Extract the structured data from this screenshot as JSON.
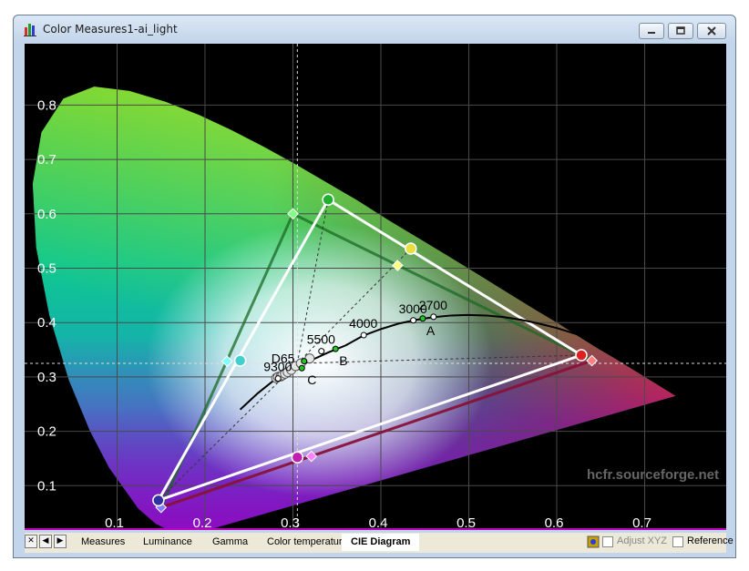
{
  "window": {
    "title": "Color Measures1-ai_light",
    "controls": [
      "minimize",
      "maximize",
      "close"
    ]
  },
  "chart_data": {
    "type": "scatter",
    "title": "",
    "xlabel": "",
    "ylabel": "",
    "xlim": [
      0,
      0.8
    ],
    "ylim": [
      0,
      0.9
    ],
    "x_ticks": [
      "0.1",
      "0.2",
      "0.3",
      "0.4",
      "0.5",
      "0.6",
      "0.7"
    ],
    "y_ticks": [
      "0.1",
      "0.2",
      "0.3",
      "0.4",
      "0.5",
      "0.6",
      "0.7",
      "0.8"
    ],
    "grid": true,
    "watermark": "hcfr.sourceforge.net",
    "reference_gamut": {
      "red": [
        0.64,
        0.33
      ],
      "green": [
        0.3,
        0.6
      ],
      "blue": [
        0.15,
        0.06
      ],
      "cyan": [
        0.225,
        0.329
      ],
      "magenta": [
        0.321,
        0.154
      ],
      "yellow": [
        0.419,
        0.505
      ]
    },
    "measured_gamut": {
      "red": [
        0.628,
        0.34
      ],
      "green": [
        0.34,
        0.626
      ],
      "blue": [
        0.147,
        0.073
      ],
      "cyan": [
        0.24,
        0.33
      ],
      "magenta": [
        0.305,
        0.152
      ],
      "yellow": [
        0.434,
        0.536
      ]
    },
    "grayscale_points": [
      [
        0.281,
        0.298
      ],
      [
        0.283,
        0.3
      ],
      [
        0.286,
        0.301
      ],
      [
        0.288,
        0.303
      ],
      [
        0.291,
        0.306
      ],
      [
        0.294,
        0.309
      ],
      [
        0.298,
        0.313
      ],
      [
        0.303,
        0.32
      ],
      [
        0.309,
        0.325
      ],
      [
        0.319,
        0.334
      ]
    ],
    "illuminants": [
      {
        "name": "D65",
        "x": 0.3127,
        "y": 0.329
      },
      {
        "name": "C",
        "x": 0.3101,
        "y": 0.3162
      },
      {
        "name": "B",
        "x": 0.3484,
        "y": 0.3516
      },
      {
        "name": "A",
        "x": 0.4476,
        "y": 0.4074
      }
    ],
    "cct_labels": [
      {
        "name": "9300",
        "x": 0.2831,
        "y": 0.2971
      },
      {
        "name": "5500",
        "x": 0.3324,
        "y": 0.3474
      },
      {
        "name": "4000",
        "x": 0.3805,
        "y": 0.3768
      },
      {
        "name": "3000",
        "x": 0.4369,
        "y": 0.4041
      },
      {
        "name": "2700",
        "x": 0.4599,
        "y": 0.4106
      }
    ],
    "cursor": {
      "x": 0.305,
      "y": 0.325
    }
  },
  "tabs": [
    "Measures",
    "Luminance",
    "Gamma",
    "Color temperature",
    "CIE Diagram"
  ],
  "active_tab": "CIE Diagram",
  "options": {
    "adjust_xyz": "Adjust XYZ",
    "reference": "Reference"
  }
}
